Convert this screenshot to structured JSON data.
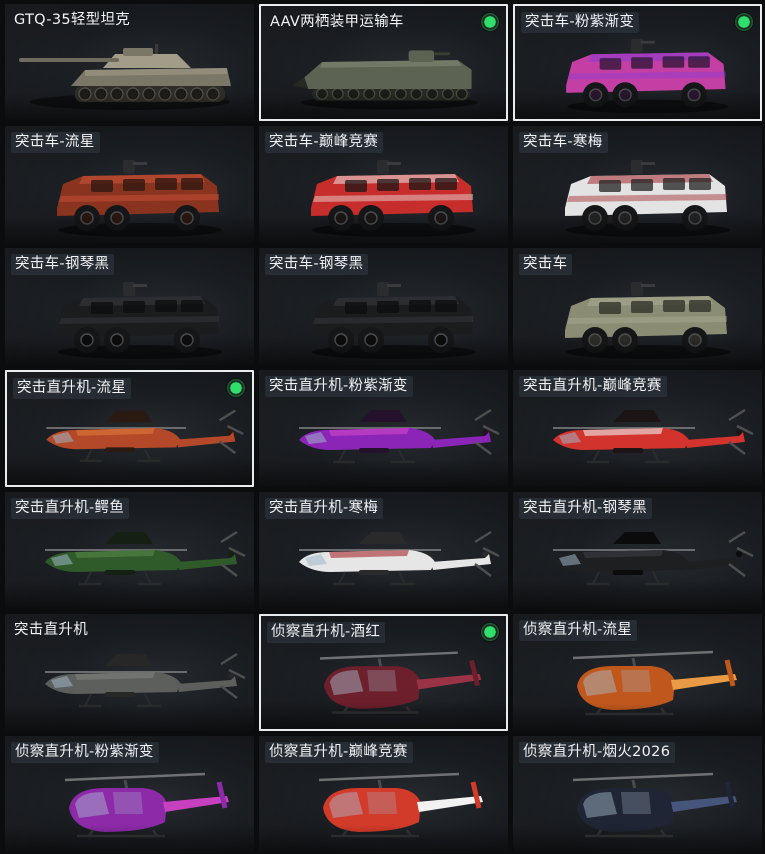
{
  "items": [
    {
      "label": "GTQ-35轻型坦克",
      "kind": "tank",
      "equipped": false,
      "badge": false,
      "colors": {
        "body": "#7b7766",
        "accent": "#a29d88",
        "dark": "#2f2d27"
      }
    },
    {
      "label": "AAV两栖装甲运输车",
      "kind": "aav",
      "equipped": true,
      "badge": true,
      "colors": {
        "body": "#5d6352",
        "accent": "#7c8470",
        "dark": "#272a23"
      }
    },
    {
      "label": "突击车-粉紫渐变",
      "kind": "truck",
      "equipped": true,
      "badge": true,
      "colors": {
        "body": "#c43fa3",
        "accent": "#8a3bd6",
        "dark": "#2a1630"
      }
    },
    {
      "label": "突击车-流星",
      "kind": "truck",
      "equipped": false,
      "badge": false,
      "colors": {
        "body": "#8a3420",
        "accent": "#d0553a",
        "dark": "#2a1510"
      }
    },
    {
      "label": "突击车-巅峰竞赛",
      "kind": "truck",
      "equipped": false,
      "badge": false,
      "colors": {
        "body": "#c72d2a",
        "accent": "#e8e8e8",
        "dark": "#1c1516"
      }
    },
    {
      "label": "突击车-寒梅",
      "kind": "truck",
      "equipped": false,
      "badge": false,
      "colors": {
        "body": "#e3e3e3",
        "accent": "#a0282d",
        "dark": "#222"
      }
    },
    {
      "label": "突击车-钢琴黑",
      "kind": "truck",
      "equipped": false,
      "badge": false,
      "colors": {
        "body": "#1b1c1e",
        "accent": "#3a3c40",
        "dark": "#0c0c0d"
      }
    },
    {
      "label": "突击车-钢琴黑",
      "kind": "truck",
      "equipped": false,
      "badge": false,
      "colors": {
        "body": "#1b1c1e",
        "accent": "#3a3c40",
        "dark": "#0c0c0d"
      }
    },
    {
      "label": "突击车",
      "kind": "truck",
      "equipped": false,
      "badge": false,
      "colors": {
        "body": "#8a8d74",
        "accent": "#a9ab92",
        "dark": "#2c2d25"
      }
    },
    {
      "label": "突击直升机-流星",
      "kind": "heli",
      "equipped": true,
      "badge": true,
      "colors": {
        "body": "#b4492a",
        "accent": "#e07a3c",
        "dark": "#2a1a12"
      }
    },
    {
      "label": "突击直升机-粉紫渐变",
      "kind": "heli",
      "equipped": false,
      "badge": false,
      "colors": {
        "body": "#8b25b8",
        "accent": "#d447c8",
        "dark": "#24122c"
      }
    },
    {
      "label": "突击直升机-巅峰竞赛",
      "kind": "heli",
      "equipped": false,
      "badge": false,
      "colors": {
        "body": "#d2332d",
        "accent": "#f0f0f0",
        "dark": "#1c1516"
      }
    },
    {
      "label": "突击直升机-鳄鱼",
      "kind": "heli",
      "equipped": false,
      "badge": false,
      "colors": {
        "body": "#2f5a2a",
        "accent": "#57894a",
        "dark": "#151f13"
      }
    },
    {
      "label": "突击直升机-寒梅",
      "kind": "heli",
      "equipped": false,
      "badge": false,
      "colors": {
        "body": "#e6e6e6",
        "accent": "#a8282c",
        "dark": "#2a2a2a"
      }
    },
    {
      "label": "突击直升机-钢琴黑",
      "kind": "heli",
      "equipped": false,
      "badge": false,
      "colors": {
        "body": "#1e1f21",
        "accent": "#3b3d41",
        "dark": "#0b0b0c"
      }
    },
    {
      "label": "突击直升机",
      "kind": "heli",
      "equipped": false,
      "badge": false,
      "colors": {
        "body": "#5d5f5c",
        "accent": "#7f817d",
        "dark": "#262726"
      }
    },
    {
      "label": "侦察直升机-酒红",
      "kind": "scout",
      "equipped": true,
      "badge": true,
      "colors": {
        "body": "#6e1f2c",
        "accent": "#9b3346",
        "dark": "#210b10"
      }
    },
    {
      "label": "侦察直升机-流星",
      "kind": "scout",
      "equipped": false,
      "badge": false,
      "colors": {
        "body": "#c0581e",
        "accent": "#e99a45",
        "dark": "#2a160b"
      }
    },
    {
      "label": "侦察直升机-粉紫渐变",
      "kind": "scout",
      "equipped": false,
      "badge": false,
      "colors": {
        "body": "#8c2aa8",
        "accent": "#c640c0",
        "dark": "#201027"
      }
    },
    {
      "label": "侦察直升机-巅峰竞赛",
      "kind": "scout",
      "equipped": false,
      "badge": false,
      "colors": {
        "body": "#d23a2a",
        "accent": "#f2f2f2",
        "dark": "#1b1414"
      }
    },
    {
      "label": "侦察直升机-烟火2026",
      "kind": "scout",
      "equipped": false,
      "badge": false,
      "colors": {
        "body": "#1f2534",
        "accent": "#46557a",
        "dark": "#0c0f16"
      }
    }
  ]
}
